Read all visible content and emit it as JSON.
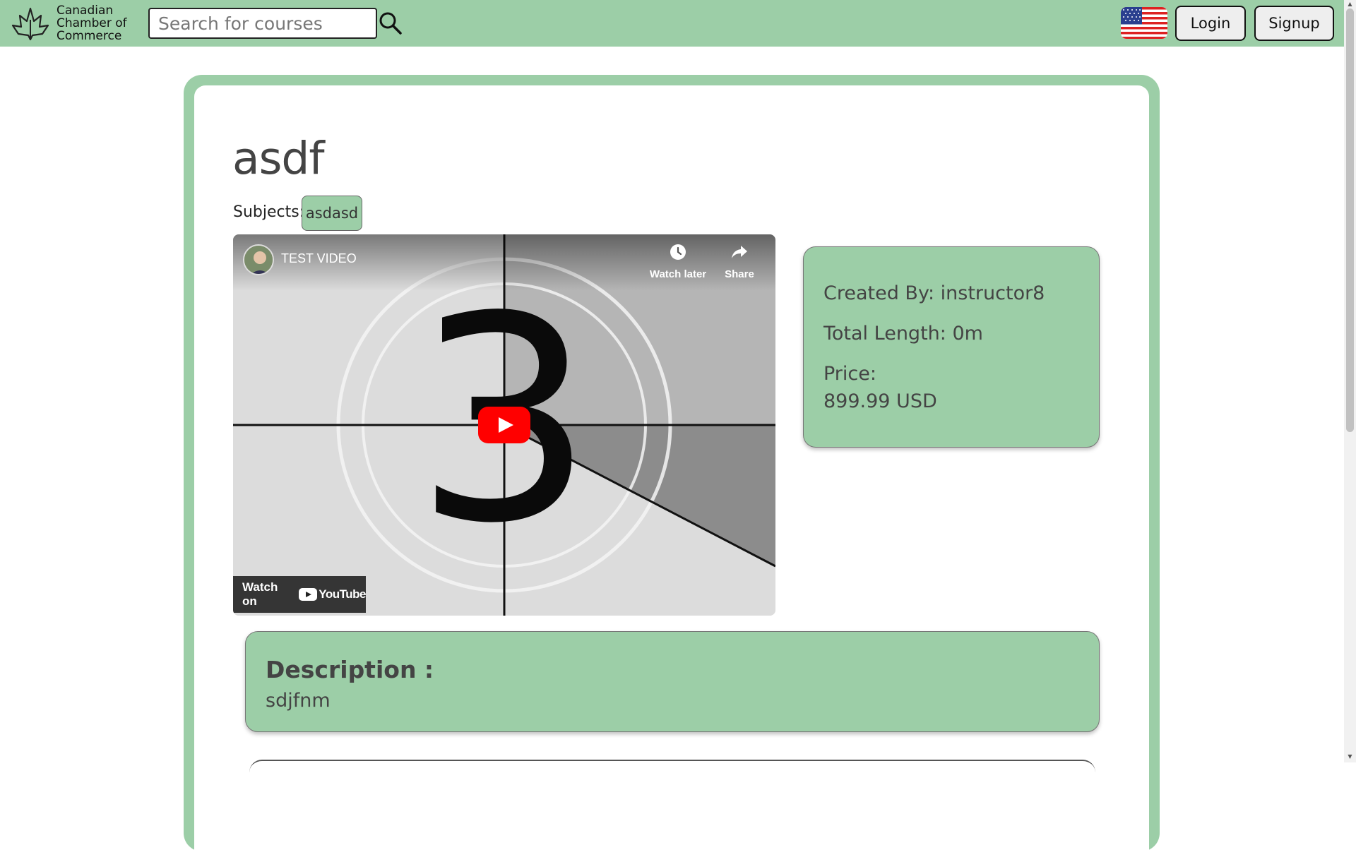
{
  "header": {
    "logo_text": [
      "Canadian",
      "Chamber of",
      "Commerce"
    ],
    "search": {
      "placeholder": "Search for courses",
      "value": ""
    },
    "icons": {
      "search": "search-icon",
      "language": "us-flag-icon",
      "logo": "maple-leaf-logo-icon"
    },
    "login_label": "Login",
    "signup_label": "Signup"
  },
  "course": {
    "title": "asdf",
    "subjects_label": "Subjects:",
    "subjects": [
      "asdasd"
    ]
  },
  "video": {
    "title": "TEST VIDEO",
    "countdown_number": "3",
    "watch_later_label": "Watch later",
    "share_label": "Share",
    "watch_on_label": "Watch on",
    "youtube_label": "YouTube",
    "icons": {
      "watch_later": "clock-icon",
      "share": "share-arrow-icon",
      "play": "play-icon"
    }
  },
  "info": {
    "created_by": "Created By: instructor8",
    "total_length": "Total Length: 0m",
    "price_label": "Price:",
    "price_value": "899.99 USD"
  },
  "description": {
    "title": "Description :",
    "text": "sdjfnm"
  },
  "colors": {
    "brand_green": "#9ccea7",
    "text_dark": "#444444",
    "youtube_red": "#ff0000"
  }
}
